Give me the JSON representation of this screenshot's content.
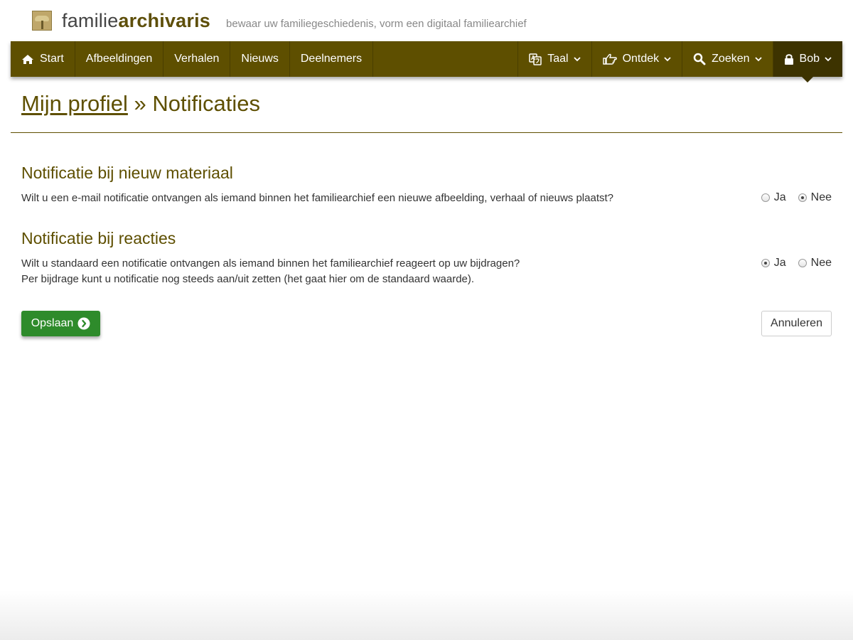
{
  "site": {
    "brand_light": "familie",
    "brand_bold": "archivaris",
    "tagline": "bewaar uw familiegeschiedenis, vorm een digitaal familiearchief",
    "logo_icon": "tree-logo-icon"
  },
  "navbar": {
    "left": [
      {
        "label": "Start",
        "icon": "home-icon"
      },
      {
        "label": "Afbeeldingen"
      },
      {
        "label": "Verhalen"
      },
      {
        "label": "Nieuws"
      },
      {
        "label": "Deelnemers"
      }
    ],
    "right": [
      {
        "label": "Taal",
        "icon": "translate-icon"
      },
      {
        "label": "Ontdek",
        "icon": "hand-point-icon"
      },
      {
        "label": "Zoeken",
        "icon": "search-icon"
      },
      {
        "label": "Bob",
        "icon": "lock-icon",
        "active": true
      }
    ],
    "colors": {
      "bar": "#5e4f00",
      "active": "#3d3300"
    }
  },
  "page": {
    "breadcrumb_link": "Mijn profiel",
    "separator": "»",
    "title": "Notificaties"
  },
  "sections": [
    {
      "heading": "Notificatie bij nieuw materiaal",
      "lines": [
        "Wilt u een e-mail notificatie ontvangen als iemand binnen het familiearchief een nieuwe afbeelding, verhaal of nieuws plaatst?"
      ],
      "options": [
        {
          "label": "Ja",
          "checked": false
        },
        {
          "label": "Nee",
          "checked": true
        }
      ]
    },
    {
      "heading": "Notificatie bij reacties",
      "lines": [
        "Wilt u standaard een notificatie ontvangen als iemand binnen het familiearchief reageert op uw bijdragen?",
        "Per bijdrage kunt u notificatie nog steeds aan/uit zetten (het gaat hier om de standaard waarde)."
      ],
      "options": [
        {
          "label": "Ja",
          "checked": true
        },
        {
          "label": "Nee",
          "checked": false
        }
      ]
    }
  ],
  "actions": {
    "save_label": "Opslaan",
    "save_icon": "chevron-circle-right-icon",
    "cancel_label": "Annuleren",
    "save_color": "#2e8b2b"
  }
}
